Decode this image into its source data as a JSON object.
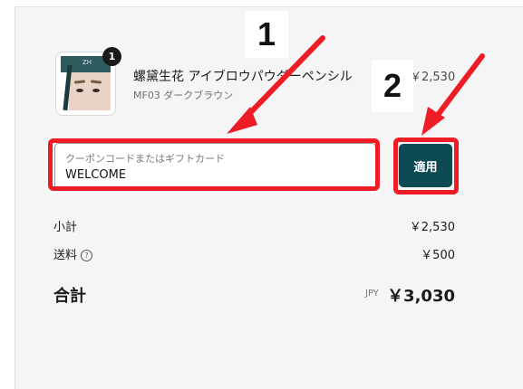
{
  "product": {
    "name": "螺黛生花 アイブロウパウダーペンシル",
    "variant": "MF03 ダークブラウン",
    "price": "￥2,530",
    "quantity": "1",
    "thumb_label": "ZH"
  },
  "coupon": {
    "placeholder": "クーポンコードまたはギフトカード",
    "value": "WELCOME",
    "apply_label": "適用"
  },
  "summary": {
    "subtotal_label": "小計",
    "subtotal_value": "￥2,530",
    "shipping_label": "送料",
    "shipping_help_icon": "?",
    "shipping_value": "￥500",
    "total_label": "合計",
    "total_currency": "JPY",
    "total_value": "￥3,030"
  },
  "annotations": {
    "step1": "1",
    "step2": "2"
  },
  "colors": {
    "accent": "#0d4a52",
    "highlight": "#ee1c25",
    "panel_bg": "#f5f5f5"
  }
}
